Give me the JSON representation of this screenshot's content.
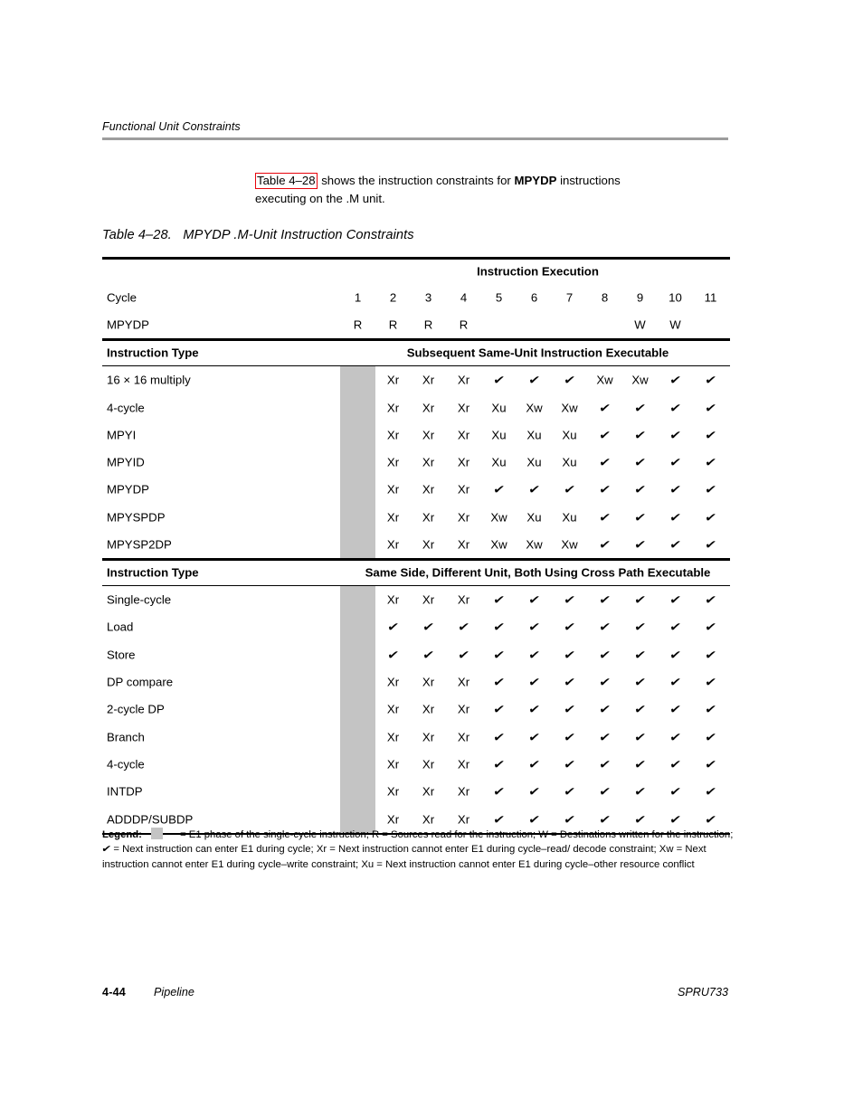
{
  "running_header": {
    "title": "Functional Unit Constraints"
  },
  "intro": {
    "xref": "Table 4–28",
    "text_before_bold": " shows the instruction constraints for ",
    "bold_term": "MPYDP",
    "text_after_bold": " instructions",
    "line2": "executing on the .M unit."
  },
  "table": {
    "caption_number": "Table 4–28.",
    "caption_title": "MPYDP .M-Unit Instruction Constraints",
    "execution_header": "Instruction Execution",
    "cycle_label": "Cycle",
    "cycles": [
      "1",
      "2",
      "3",
      "4",
      "5",
      "6",
      "7",
      "8",
      "9",
      "10",
      "11"
    ],
    "pipeline_row": {
      "label": "MPYDP",
      "values": [
        "R",
        "R",
        "R",
        "R",
        "",
        "",
        "",
        "",
        "W",
        "W",
        ""
      ]
    },
    "sections": [
      {
        "col_header": "Instruction Type",
        "span_header": "Subsequent Same-Unit Instruction Executable",
        "rows": [
          {
            "label": "16 × 16 multiply",
            "values": [
              "",
              "Xr",
              "Xr",
              "Xr",
              "✓",
              "✓",
              "✓",
              "Xw",
              "Xw",
              "✓",
              "✓"
            ]
          },
          {
            "label": "4-cycle",
            "values": [
              "",
              "Xr",
              "Xr",
              "Xr",
              "Xu",
              "Xw",
              "Xw",
              "✓",
              "✓",
              "✓",
              "✓"
            ]
          },
          {
            "label": "MPYI",
            "values": [
              "",
              "Xr",
              "Xr",
              "Xr",
              "Xu",
              "Xu",
              "Xu",
              "✓",
              "✓",
              "✓",
              "✓"
            ]
          },
          {
            "label": "MPYID",
            "values": [
              "",
              "Xr",
              "Xr",
              "Xr",
              "Xu",
              "Xu",
              "Xu",
              "✓",
              "✓",
              "✓",
              "✓"
            ]
          },
          {
            "label": "MPYDP",
            "values": [
              "",
              "Xr",
              "Xr",
              "Xr",
              "✓",
              "✓",
              "✓",
              "✓",
              "✓",
              "✓",
              "✓"
            ]
          },
          {
            "label": "MPYSPDP",
            "values": [
              "",
              "Xr",
              "Xr",
              "Xr",
              "Xw",
              "Xu",
              "Xu",
              "✓",
              "✓",
              "✓",
              "✓"
            ]
          },
          {
            "label": "MPYSP2DP",
            "values": [
              "",
              "Xr",
              "Xr",
              "Xr",
              "Xw",
              "Xw",
              "Xw",
              "✓",
              "✓",
              "✓",
              "✓"
            ]
          }
        ]
      },
      {
        "col_header": "Instruction Type",
        "span_header": "Same Side, Different Unit, Both Using Cross Path Executable",
        "rows": [
          {
            "label": "Single-cycle",
            "values": [
              "",
              "Xr",
              "Xr",
              "Xr",
              "✓",
              "✓",
              "✓",
              "✓",
              "✓",
              "✓",
              "✓"
            ]
          },
          {
            "label": "Load",
            "values": [
              "",
              "✓",
              "✓",
              "✓",
              "✓",
              "✓",
              "✓",
              "✓",
              "✓",
              "✓",
              "✓"
            ]
          },
          {
            "label": "Store",
            "values": [
              "",
              "✓",
              "✓",
              "✓",
              "✓",
              "✓",
              "✓",
              "✓",
              "✓",
              "✓",
              "✓"
            ]
          },
          {
            "label": "DP compare",
            "values": [
              "",
              "Xr",
              "Xr",
              "Xr",
              "✓",
              "✓",
              "✓",
              "✓",
              "✓",
              "✓",
              "✓"
            ]
          },
          {
            "label": "2-cycle DP",
            "values": [
              "",
              "Xr",
              "Xr",
              "Xr",
              "✓",
              "✓",
              "✓",
              "✓",
              "✓",
              "✓",
              "✓"
            ]
          },
          {
            "label": "Branch",
            "values": [
              "",
              "Xr",
              "Xr",
              "Xr",
              "✓",
              "✓",
              "✓",
              "✓",
              "✓",
              "✓",
              "✓"
            ]
          },
          {
            "label": "4-cycle",
            "values": [
              "",
              "Xr",
              "Xr",
              "Xr",
              "✓",
              "✓",
              "✓",
              "✓",
              "✓",
              "✓",
              "✓"
            ]
          },
          {
            "label": "INTDP",
            "values": [
              "",
              "Xr",
              "Xr",
              "Xr",
              "✓",
              "✓",
              "✓",
              "✓",
              "✓",
              "✓",
              "✓"
            ]
          },
          {
            "label": "ADDDP/SUBDP",
            "values": [
              "",
              "Xr",
              "Xr",
              "Xr",
              "✓",
              "✓",
              "✓",
              "✓",
              "✓",
              "✓",
              "✓"
            ]
          }
        ]
      }
    ]
  },
  "legend": {
    "label": "Legend:",
    "part1": " = E1 phase of the single-cycle instruction; R = Sources read for the instruction; W = Destinations written for the instruction; ",
    "part2": " = Next instruction can enter E1 during cycle; Xr = Next instruction cannot enter E1 during cycle–read/ decode constraint; Xw = Next instruction cannot enter E1 during cycle–write constraint; Xu = Next instruction cannot enter E1 during cycle–other resource conflict"
  },
  "footer": {
    "page_number": "4-44",
    "chapter": "Pipeline",
    "doc_id": "SPRU733"
  },
  "colors": {
    "link_box": "#e8030b",
    "grey_band": "#c4c4c4",
    "header_rule": "#9d9d9d"
  }
}
